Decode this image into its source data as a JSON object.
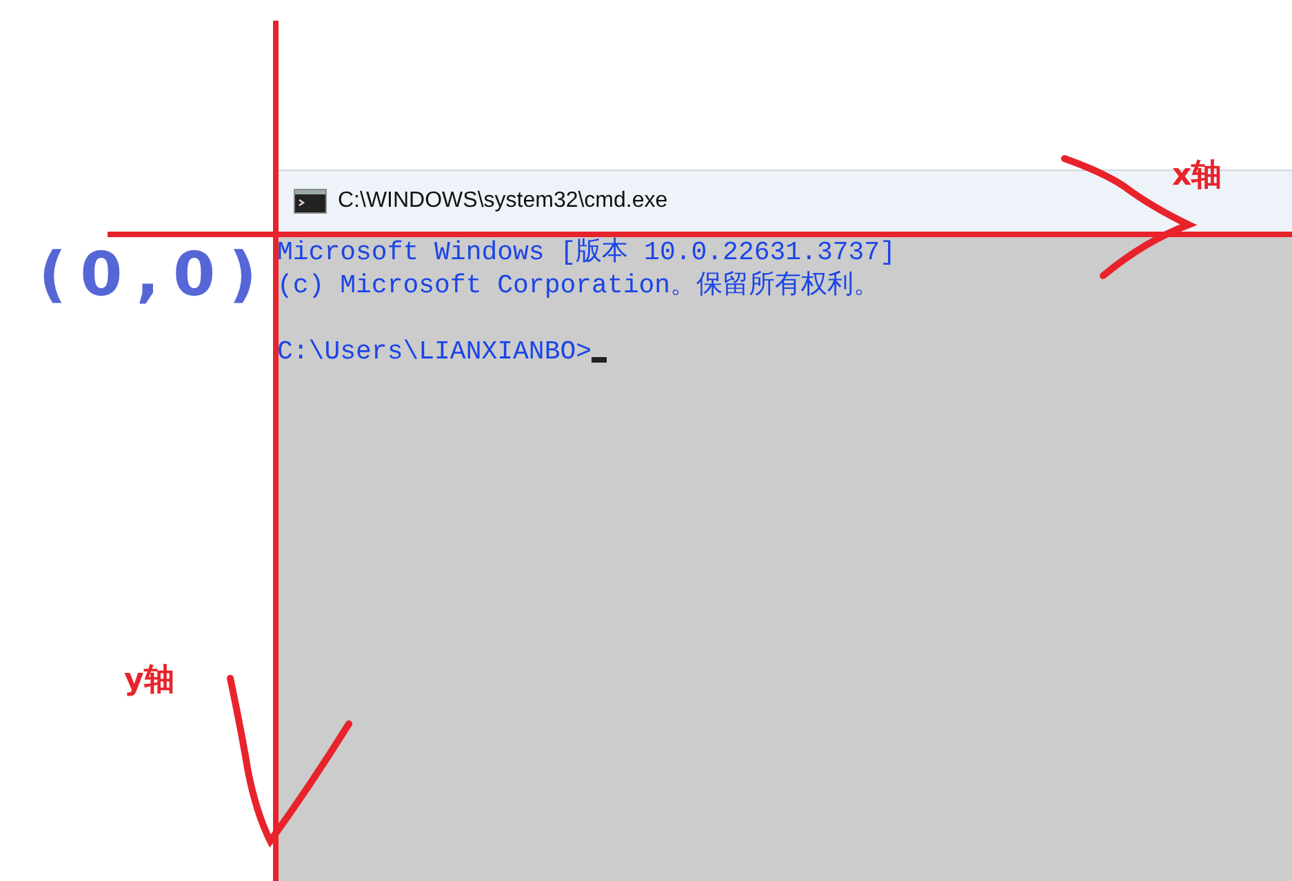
{
  "window": {
    "title": "C:\\WINDOWS\\system32\\cmd.exe"
  },
  "console": {
    "banner": [
      "Microsoft Windows [版本 10.0.22631.3737]",
      "(c) Microsoft Corporation。保留所有权利。"
    ],
    "prompt": "C:\\Users\\LIANXIANBO>"
  },
  "annotations": {
    "origin_label": "(0,0)",
    "x_axis_label": "x轴",
    "y_axis_label": "y轴"
  }
}
